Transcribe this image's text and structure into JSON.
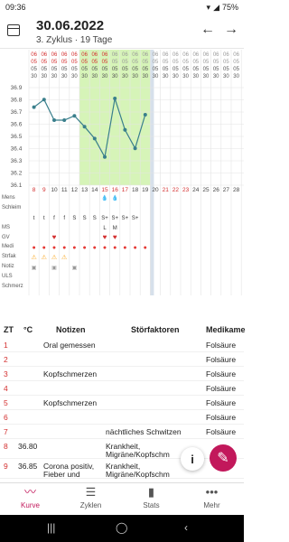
{
  "status": {
    "time": "09:36",
    "battery": "75%"
  },
  "header": {
    "date": "30.06.2022",
    "subtitle": "3. Zyklus · 19 Tage"
  },
  "chart": {
    "days": [
      "8",
      "9",
      "10",
      "11",
      "12",
      "13",
      "14",
      "15",
      "16",
      "17",
      "18",
      "19",
      "20",
      "21",
      "22",
      "23",
      "24",
      "25",
      "26",
      "27",
      "28"
    ],
    "y_ticks": [
      "36.9",
      "36.8",
      "36.7",
      "36.6",
      "36.5",
      "36.4",
      "36.3",
      "36.2",
      "36.1"
    ],
    "temps": [
      36.77,
      36.84,
      36.65,
      36.65,
      36.69,
      36.59,
      36.48,
      36.31,
      36.85,
      36.56,
      36.39,
      36.7
    ],
    "row_labels": [
      "Mens",
      "Schleim",
      "MS",
      "GV",
      "Medi",
      "Strfak",
      "Notiz",
      "ULS",
      "Schmerz"
    ],
    "schleim": [
      "t",
      "t",
      "f",
      "f",
      "S",
      "S",
      "S",
      "S+",
      "S+",
      "S+",
      "S+"
    ],
    "ms": [
      "",
      "",
      "",
      "",
      "",
      "",
      "",
      "L",
      "M"
    ]
  },
  "table": {
    "headers": [
      "ZT",
      "°C",
      "Notizen",
      "Störfaktoren",
      "Medikame"
    ],
    "rows": [
      {
        "zt": "1",
        "temp": "",
        "note": "Oral gemessen",
        "stor": "",
        "med": "Folsäure"
      },
      {
        "zt": "2",
        "temp": "",
        "note": "",
        "stor": "",
        "med": "Folsäure"
      },
      {
        "zt": "3",
        "temp": "",
        "note": "Kopfschmerzen",
        "stor": "",
        "med": "Folsäure"
      },
      {
        "zt": "4",
        "temp": "",
        "note": "",
        "stor": "",
        "med": "Folsäure"
      },
      {
        "zt": "5",
        "temp": "",
        "note": "Kopfschmerzen",
        "stor": "",
        "med": "Folsäure"
      },
      {
        "zt": "6",
        "temp": "",
        "note": "",
        "stor": "",
        "med": "Folsäure"
      },
      {
        "zt": "7",
        "temp": "",
        "note": "",
        "stor": "nächtliches Schwitzen",
        "med": "Folsäure"
      },
      {
        "zt": "8",
        "temp": "36.80",
        "note": "",
        "stor": "Krankheit,",
        "stor2": "Migräne/Kopfschm",
        "med": ""
      },
      {
        "zt": "9",
        "temp": "36.85",
        "note": "Corona positiv,",
        "note2": "Fieber und",
        "stor": "Krankheit,",
        "stor2": "Migräne/Kopfschm",
        "med": ""
      }
    ]
  },
  "nav": {
    "kurve": "Kurve",
    "zyklen": "Zyklen",
    "stats": "Stats",
    "mehr": "Mehr"
  },
  "colors": {
    "accent": "#c2185b",
    "green": "#c8f0a0",
    "line": "#3a7f8c"
  }
}
